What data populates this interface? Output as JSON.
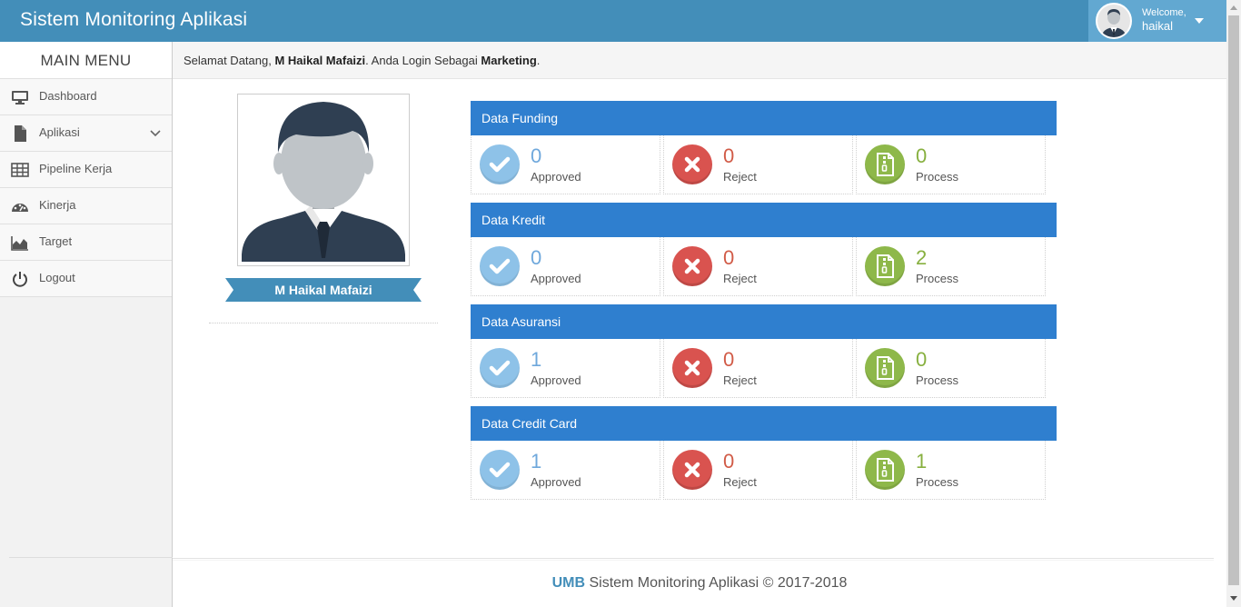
{
  "app": {
    "title": "Sistem Monitoring Aplikasi"
  },
  "user": {
    "welcome": "Welcome,",
    "name": "haikal"
  },
  "sidebar": {
    "title": "MAIN MENU",
    "items": [
      {
        "label": "Dashboard",
        "icon": "desktop-icon"
      },
      {
        "label": "Aplikasi",
        "icon": "file-icon"
      },
      {
        "label": "Pipeline Kerja",
        "icon": "table-icon"
      },
      {
        "label": "Kinerja",
        "icon": "dashboard-gauge-icon"
      },
      {
        "label": "Target",
        "icon": "area-chart-icon"
      },
      {
        "label": "Logout",
        "icon": "power-icon"
      }
    ]
  },
  "welcome_bar": {
    "prefix": "Selamat Datang, ",
    "name": "M Haikal Mafaizi",
    "middle": ". Anda Login Sebagai ",
    "role": "Marketing",
    "suffix": "."
  },
  "profile": {
    "name": "M Haikal Mafaizi"
  },
  "labels": {
    "approved": "Approved",
    "reject": "Reject",
    "process": "Process"
  },
  "panels": [
    {
      "title": "Data Funding",
      "approved": "0",
      "reject": "0",
      "process": "0"
    },
    {
      "title": "Data Kredit",
      "approved": "0",
      "reject": "0",
      "process": "2"
    },
    {
      "title": "Data Asuransi",
      "approved": "1",
      "reject": "0",
      "process": "0"
    },
    {
      "title": "Data Credit Card",
      "approved": "1",
      "reject": "0",
      "process": "1"
    }
  ],
  "footer": {
    "brand": "UMB",
    "text": " Sistem Monitoring Aplikasi © 2017-2018"
  },
  "colors": {
    "header": "#438eb9",
    "panel_head": "#2f7fcf",
    "approved": "#8ec2e8",
    "reject": "#d9534f",
    "process": "#8eb84a"
  }
}
